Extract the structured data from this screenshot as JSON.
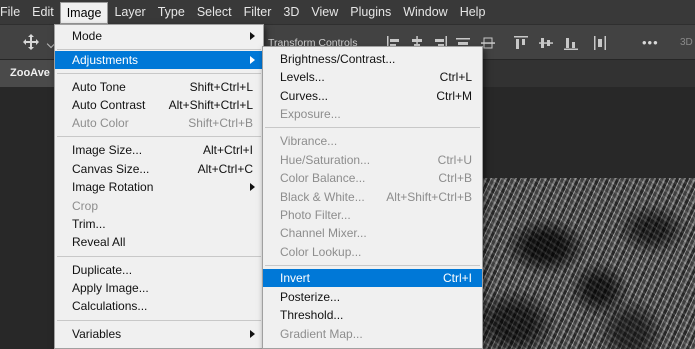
{
  "menubar": {
    "items": [
      "File",
      "Edit",
      "Image",
      "Layer",
      "Type",
      "Select",
      "Filter",
      "3D",
      "View",
      "Plugins",
      "Window",
      "Help"
    ],
    "active": "Image"
  },
  "options_bar": {
    "transform_controls_label": "Transform Controls",
    "more_label": "•••",
    "trailing_label": "3D"
  },
  "document_tab": {
    "title": "ZooAve"
  },
  "image_menu": {
    "items": [
      {
        "label": "Mode",
        "shortcut": "",
        "submenu": true,
        "disabled": false
      },
      {
        "label": "Adjustments",
        "shortcut": "",
        "submenu": true,
        "disabled": false,
        "highlighted": true
      },
      {
        "label": "Auto Tone",
        "shortcut": "Shift+Ctrl+L",
        "disabled": false
      },
      {
        "label": "Auto Contrast",
        "shortcut": "Alt+Shift+Ctrl+L",
        "disabled": false
      },
      {
        "label": "Auto Color",
        "shortcut": "Shift+Ctrl+B",
        "disabled": true
      },
      {
        "label": "Image Size...",
        "shortcut": "Alt+Ctrl+I",
        "disabled": false
      },
      {
        "label": "Canvas Size...",
        "shortcut": "Alt+Ctrl+C",
        "disabled": false
      },
      {
        "label": "Image Rotation",
        "shortcut": "",
        "submenu": true,
        "disabled": false
      },
      {
        "label": "Crop",
        "shortcut": "",
        "disabled": true
      },
      {
        "label": "Trim...",
        "shortcut": "",
        "disabled": false
      },
      {
        "label": "Reveal All",
        "shortcut": "",
        "disabled": false
      },
      {
        "label": "Duplicate...",
        "shortcut": "",
        "disabled": false
      },
      {
        "label": "Apply Image...",
        "shortcut": "",
        "disabled": false
      },
      {
        "label": "Calculations...",
        "shortcut": "",
        "disabled": false
      },
      {
        "label": "Variables",
        "shortcut": "",
        "submenu": true,
        "disabled": false
      }
    ]
  },
  "adjustments_menu": {
    "items": [
      {
        "label": "Brightness/Contrast...",
        "shortcut": "",
        "disabled": false
      },
      {
        "label": "Levels...",
        "shortcut": "Ctrl+L",
        "disabled": false
      },
      {
        "label": "Curves...",
        "shortcut": "Ctrl+M",
        "disabled": false
      },
      {
        "label": "Exposure...",
        "shortcut": "",
        "disabled": true
      },
      {
        "label": "Vibrance...",
        "shortcut": "",
        "disabled": true
      },
      {
        "label": "Hue/Saturation...",
        "shortcut": "Ctrl+U",
        "disabled": true
      },
      {
        "label": "Color Balance...",
        "shortcut": "Ctrl+B",
        "disabled": true
      },
      {
        "label": "Black & White...",
        "shortcut": "Alt+Shift+Ctrl+B",
        "disabled": true
      },
      {
        "label": "Photo Filter...",
        "shortcut": "",
        "disabled": true
      },
      {
        "label": "Channel Mixer...",
        "shortcut": "",
        "disabled": true
      },
      {
        "label": "Color Lookup...",
        "shortcut": "",
        "disabled": true
      },
      {
        "label": "Invert",
        "shortcut": "Ctrl+I",
        "disabled": false,
        "highlighted": true
      },
      {
        "label": "Posterize...",
        "shortcut": "",
        "disabled": false
      },
      {
        "label": "Threshold...",
        "shortcut": "",
        "disabled": false
      },
      {
        "label": "Gradient Map...",
        "shortcut": "",
        "disabled": true
      }
    ]
  },
  "colors": {
    "menubar_bg": "#393939",
    "menu_bg": "#f0f0f0",
    "highlight": "#0078d7",
    "disabled_text": "#8d8d8d"
  }
}
